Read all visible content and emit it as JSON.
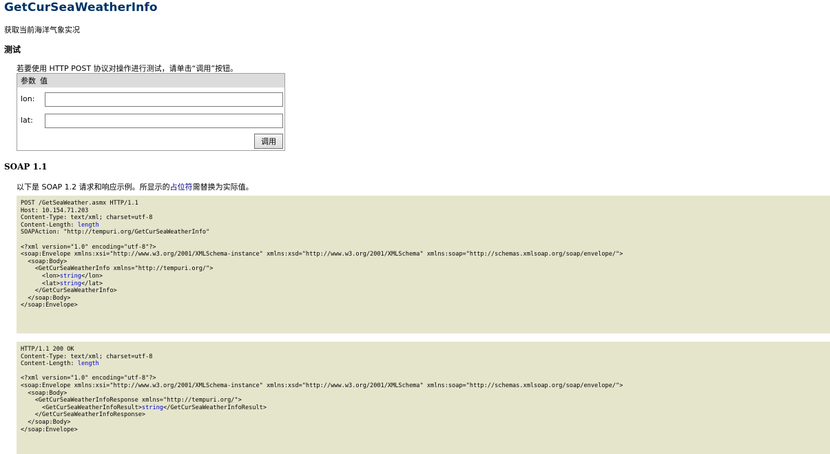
{
  "operation": {
    "name": "GetCurSeaWeatherInfo",
    "description": "获取当前海洋气象实况"
  },
  "test": {
    "heading": "测试",
    "intro": "若要使用 HTTP POST 协议对操作进行测试，请单击“调用”按钮。",
    "col_param": "参数",
    "col_value": "值",
    "params": [
      {
        "label": "lon:",
        "value": ""
      },
      {
        "label": "lat:",
        "value": ""
      }
    ],
    "invoke_label": "调用"
  },
  "soap": {
    "heading": "SOAP 1.1",
    "intro_before": "以下是 SOAP 1.2 请求和响应示例。所显示的",
    "intro_placeholder": "占位符",
    "intro_after": "需替换为实际值。",
    "request": {
      "l1": "POST /GetSeaWeather.asmx HTTP/1.1",
      "l2": "Host: 10.154.71.203",
      "l3": "Content-Type: text/xml; charset=utf-8",
      "l4_prefix": "Content-Length: ",
      "l4_value": "length",
      "l5": "SOAPAction: \"http://tempuri.org/GetCurSeaWeatherInfo\"",
      "l6": "<?xml version=\"1.0\" encoding=\"utf-8\"?>",
      "l7": "<soap:Envelope xmlns:xsi=\"http://www.w3.org/2001/XMLSchema-instance\" xmlns:xsd=\"http://www.w3.org/2001/XMLSchema\" xmlns:soap=\"http://schemas.xmlsoap.org/soap/envelope/\">",
      "l8": "  <soap:Body>",
      "l9": "    <GetCurSeaWeatherInfo xmlns=\"http://tempuri.org/\">",
      "l10_open": "      <lon>",
      "l10_value": "string",
      "l10_close": "</lon>",
      "l11_open": "      <lat>",
      "l11_value": "string",
      "l11_close": "</lat>",
      "l12": "    </GetCurSeaWeatherInfo>",
      "l13": "  </soap:Body>",
      "l14": "</soap:Envelope>"
    },
    "response": {
      "l1": "HTTP/1.1 200 OK",
      "l2": "Content-Type: text/xml; charset=utf-8",
      "l3_prefix": "Content-Length: ",
      "l3_value": "length",
      "l4": "<?xml version=\"1.0\" encoding=\"utf-8\"?>",
      "l5": "<soap:Envelope xmlns:xsi=\"http://www.w3.org/2001/XMLSchema-instance\" xmlns:xsd=\"http://www.w3.org/2001/XMLSchema\" xmlns:soap=\"http://schemas.xmlsoap.org/soap/envelope/\">",
      "l6": "  <soap:Body>",
      "l7": "    <GetCurSeaWeatherInfoResponse xmlns=\"http://tempuri.org/\">",
      "l8_open": "      <GetCurSeaWeatherInfoResult>",
      "l8_value": "string",
      "l8_close": "</GetCurSeaWeatherInfoResult>",
      "l9": "    </GetCurSeaWeatherInfoResponse>",
      "l10": "  </soap:Body>",
      "l11": "</soap:Envelope>"
    }
  }
}
